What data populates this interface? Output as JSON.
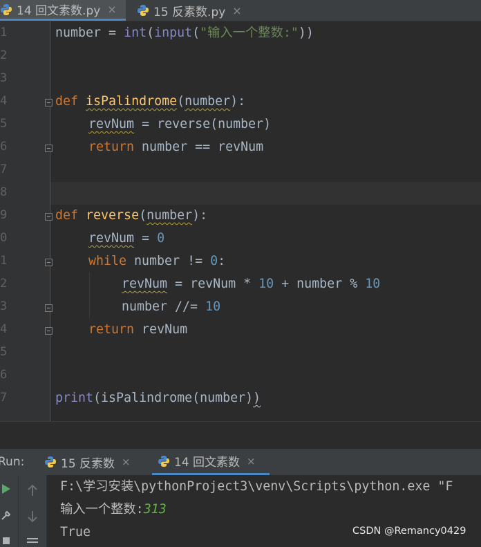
{
  "tabs": [
    {
      "label": "14 回文素数.py",
      "close": "×",
      "icon": "python-icon",
      "active": true
    },
    {
      "label": "15 反素数.py",
      "close": "×",
      "icon": "python-icon",
      "active": false
    }
  ],
  "line_numbers": [
    "1",
    "2",
    "3",
    "4",
    "5",
    "6",
    "7",
    "8",
    "9",
    "0",
    "1",
    "2",
    "3",
    "4",
    "5",
    "6",
    "7"
  ],
  "code": {
    "l1": {
      "a": "number = ",
      "b": "int",
      "c": "(",
      "d": "input",
      "e": "(",
      "f": "\"输入一个整数:\"",
      "g": "))"
    },
    "l4": {
      "def": "def ",
      "name": "isPalindrome",
      "p1": "(",
      "param": "number",
      "p2": "):"
    },
    "l5": {
      "var": "revNum",
      "rest": " = reverse(number)"
    },
    "l6": {
      "kw": "return",
      "rest": " number == revNum"
    },
    "l9": {
      "def": "def ",
      "name": "reverse",
      "p1": "(",
      "param": "number",
      "p2": "):"
    },
    "l10": {
      "var": "revNum",
      "eq": " = ",
      "num": "0"
    },
    "l11": {
      "kw": "while",
      "rest": " number != ",
      "num": "0",
      "colon": ":"
    },
    "l12": {
      "var": "revNum",
      "mid": " = revNum * ",
      "n1": "10",
      "mid2": " + number % ",
      "n2": "10"
    },
    "l13": {
      "a": "number //= ",
      "num": "10"
    },
    "l14": {
      "kw": "return",
      "rest": " revNum"
    },
    "l17": {
      "fn": "print",
      "a": "(isPalindrome(number)",
      "b": ")"
    }
  },
  "run": {
    "label": "Run:",
    "tabs": [
      {
        "label": "15 反素数",
        "close": "×",
        "active": false
      },
      {
        "label": "14 回文素数",
        "close": "×",
        "active": true
      }
    ],
    "output": {
      "path": "F:\\学习安装\\pythonProject3\\venv\\Scripts\\python.exe \"F",
      "prompt": "输入一个整数:",
      "input": "313",
      "result": "True"
    }
  },
  "watermark": "CSDN @Remancy0429",
  "colors": {
    "keyword": "#cc7832",
    "function": "#ffc66d",
    "builtin": "#8888c6",
    "string": "#6a8759",
    "number": "#6897bb",
    "accent": "#4a88c7"
  }
}
